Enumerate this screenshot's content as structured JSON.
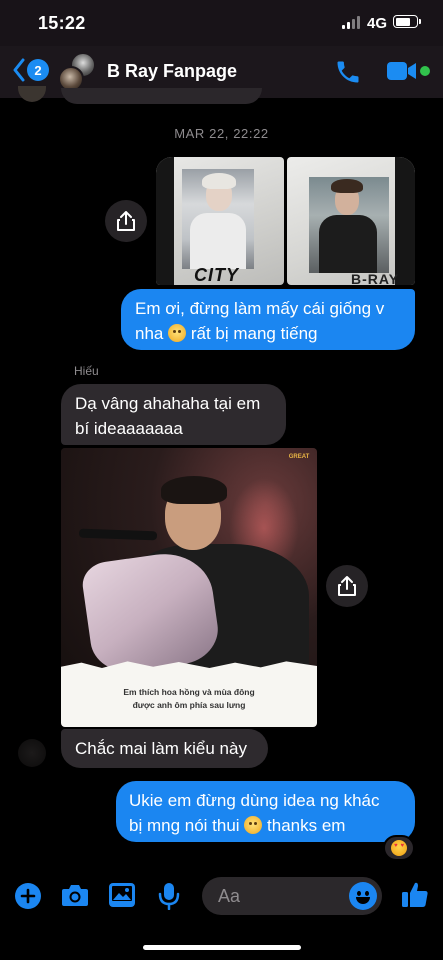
{
  "status_bar": {
    "time": "15:22",
    "network": "4G"
  },
  "header": {
    "back_count": "2",
    "title": "B Ray Fanpage"
  },
  "conversation": {
    "timestamp": "MAR 22, 22:22",
    "messages": [
      {
        "from": "me",
        "type": "photos",
        "photo_texts": [
          "CITY",
          "B-RAY"
        ]
      },
      {
        "from": "me",
        "type": "text",
        "line1": "Em ơi, đừng làm mấy cái giống v",
        "line2a": "nha",
        "line2b": "rất bị mang tiếng"
      },
      {
        "from": "them",
        "sender": "Hiếu",
        "type": "text",
        "line1": "Dạ vâng ahahaha tại em",
        "line2": "bí ideaaaaaaa"
      },
      {
        "from": "them",
        "type": "photo",
        "caption_line1": "Em thích hoa hồng và mùa đông",
        "caption_line2": "được anh ôm phía sau lưng",
        "logo": "GREAT"
      },
      {
        "from": "them",
        "type": "text",
        "line1": "Chắc mai làm kiểu này"
      },
      {
        "from": "me",
        "type": "text",
        "line1": "Ukie em đừng dùng idea ng khác",
        "line2a": "bị mng nói thui",
        "line2b": "thanks em",
        "reaction": "heart-eyes"
      }
    ]
  },
  "composer": {
    "placeholder": "Aa"
  },
  "colors": {
    "accent": "#1b86f1",
    "incoming_bubble": "#2e2a2e",
    "background": "#000000",
    "online": "#31c24c"
  }
}
